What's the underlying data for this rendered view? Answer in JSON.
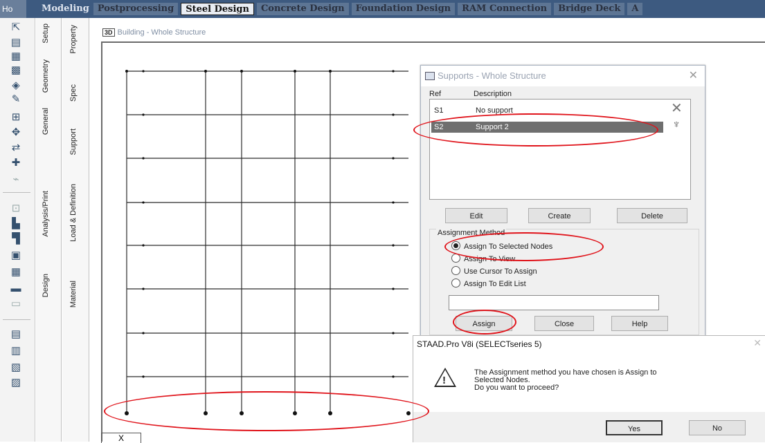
{
  "top_tabs": {
    "first_label": "Ho",
    "tabs": [
      "Modeling",
      "Postprocessing",
      "Steel Design",
      "Concrete Design",
      "Foundation Design",
      "RAM Connection",
      "Bridge Deck",
      "A"
    ],
    "active": "Steel Design"
  },
  "page_control": {
    "col1": [
      "Setup",
      "Geometry",
      "General",
      "Analysis/Print",
      "Design"
    ],
    "col2": [
      "Property",
      "Spec",
      "Support",
      "Load & Definition",
      "Material"
    ]
  },
  "view": {
    "icon": "3D",
    "title": "Building - Whole Structure",
    "axis_label": "X"
  },
  "supports_dialog": {
    "title": "Supports - Whole Structure",
    "col_ref": "Ref",
    "col_desc": "Description",
    "rows": [
      {
        "ref": "S1",
        "desc": "No support"
      },
      {
        "ref": "S2",
        "desc": "Support 2"
      }
    ],
    "selected_ref": "S2",
    "buttons": {
      "edit": "Edit",
      "create": "Create",
      "delete": "Delete",
      "assign": "Assign",
      "close": "Close",
      "help": "Help"
    },
    "assignment_method": {
      "label": "Assignment Method",
      "options": [
        "Assign To Selected Nodes",
        "Assign To View",
        "Use Cursor To Assign",
        "Assign To Edit List"
      ],
      "selected": "Assign To Selected Nodes"
    },
    "edit_list_value": ""
  },
  "message_box": {
    "title": "STAAD.Pro V8i (SELECTseries 5)",
    "line1": "The Assignment method you have chosen is Assign to",
    "line2": "Selected Nodes.",
    "line3": "Do you want to proceed?",
    "yes": "Yes",
    "no": "No"
  },
  "colors": {
    "annotation": "#e0141b",
    "ribbon": "#3d5a80",
    "selected_row": "#6f6f6f"
  }
}
